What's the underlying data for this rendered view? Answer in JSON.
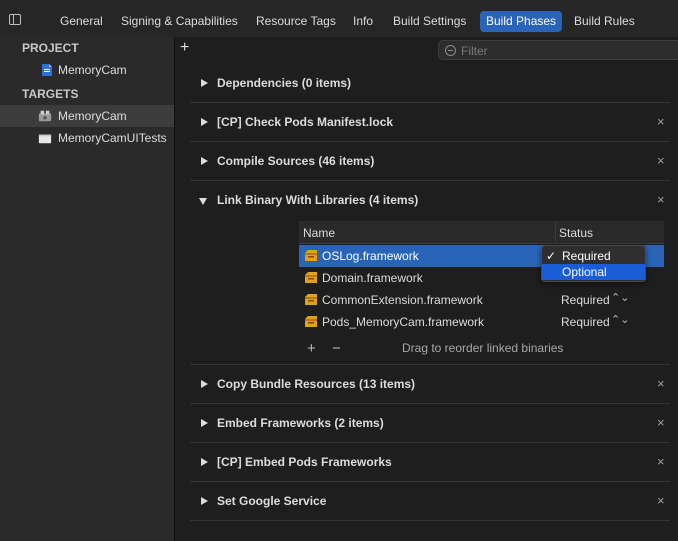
{
  "tabs": [
    {
      "label": "General",
      "active": false
    },
    {
      "label": "Signing & Capabilities",
      "active": false
    },
    {
      "label": "Resource Tags",
      "active": false
    },
    {
      "label": "Info",
      "active": false
    },
    {
      "label": "Build Settings",
      "active": false
    },
    {
      "label": "Build Phases",
      "active": true
    },
    {
      "label": "Build Rules",
      "active": false
    }
  ],
  "sidebar": {
    "project_header": "PROJECT",
    "project_item": "MemoryCam",
    "targets_header": "TARGETS",
    "targets": [
      {
        "label": "MemoryCam",
        "selected": true
      },
      {
        "label": "MemoryCamUITests",
        "selected": false
      }
    ]
  },
  "toolbar": {
    "add_symbol": "+",
    "filter_placeholder": "Filter"
  },
  "phases": [
    {
      "title": "Dependencies (0 items)",
      "expanded": false,
      "removable": false
    },
    {
      "title": "[CP] Check Pods Manifest.lock",
      "expanded": false,
      "removable": true
    },
    {
      "title": "Compile Sources (46 items)",
      "expanded": false,
      "removable": true
    },
    {
      "title": "Link Binary With Libraries (4 items)",
      "expanded": true,
      "removable": true
    },
    {
      "title": "Copy Bundle Resources (13 items)",
      "expanded": false,
      "removable": true
    },
    {
      "title": "Embed Frameworks (2 items)",
      "expanded": false,
      "removable": true
    },
    {
      "title": "[CP] Embed Pods Frameworks",
      "expanded": false,
      "removable": true
    },
    {
      "title": "Set Google Service",
      "expanded": false,
      "removable": true
    }
  ],
  "close_symbol": "×",
  "link_table": {
    "columns": [
      "Name",
      "Status"
    ],
    "rows": [
      {
        "name": "OSLog.framework",
        "status": "",
        "selected": true
      },
      {
        "name": "Domain.framework",
        "status": "",
        "selected": false
      },
      {
        "name": "CommonExtension.framework",
        "status": "Required",
        "selected": false
      },
      {
        "name": "Pods_MemoryCam.framework",
        "status": "Required",
        "selected": false
      }
    ],
    "add_symbol": "+",
    "remove_symbol": "−",
    "hint": "Drag to reorder linked binaries"
  },
  "status_dropdown": {
    "options": [
      {
        "label": "Required",
        "checked": true
      },
      {
        "label": "Optional",
        "checked": false
      }
    ],
    "check_mark": "✓"
  },
  "colors": {
    "accent": "#2a64b8",
    "menu_highlight": "#1a5dd6",
    "framework_icon": "#e0a11b"
  }
}
